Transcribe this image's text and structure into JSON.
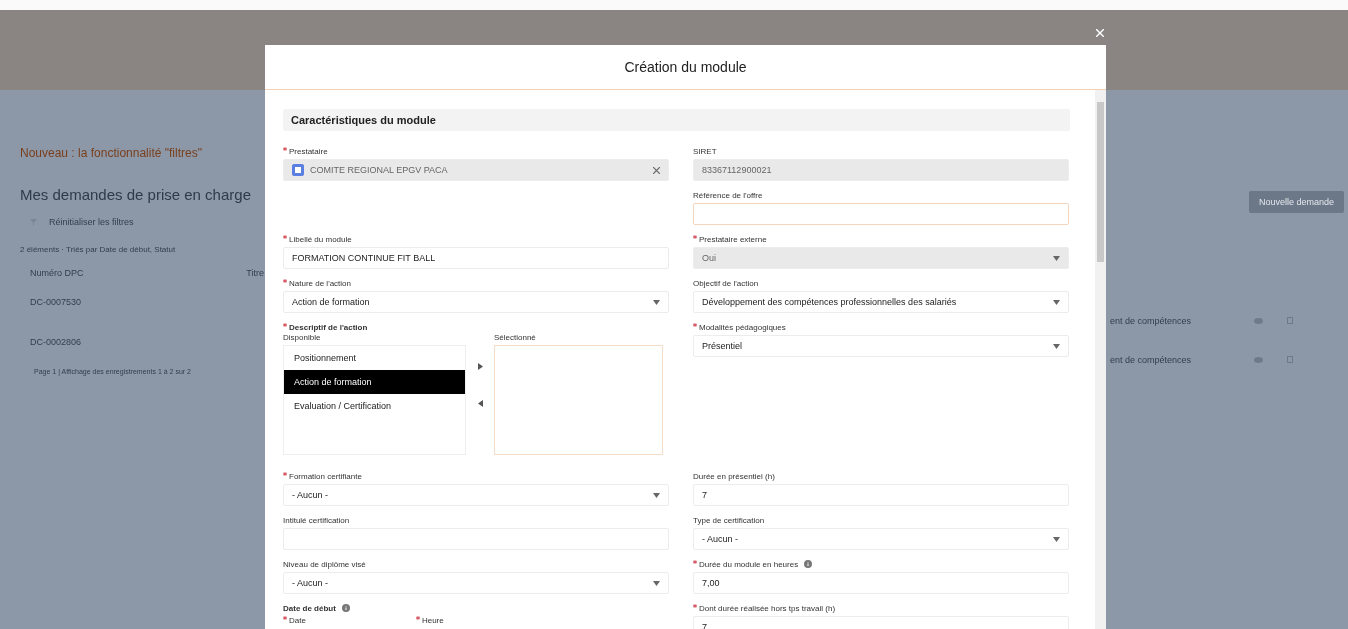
{
  "background": {
    "notice": "Nouveau : la fonctionnalité \"filtres\"",
    "title": "Mes demandes de prise en charge",
    "reset_filters": "Réinitialiser les filtres",
    "summary": "2 éléments · Triés par Date de début, Statut",
    "table": {
      "columns": [
        "Numéro DPC",
        "Titre"
      ],
      "rows": [
        {
          "number": "DC-0007530",
          "objective": "ent de compétences"
        },
        {
          "number": "DC-0002806",
          "objective": "ent de compétences"
        }
      ]
    },
    "pagination": "Page 1 | Affichage des enregistrements 1 à 2 sur 2",
    "new_request_button": "Nouvelle demande"
  },
  "modal": {
    "title": "Création du module",
    "section": "Caractéristiques du module",
    "left": [
      {
        "kind": "lookup",
        "label": "Prestataire",
        "required": true,
        "value": "COMITE REGIONAL EPGV PACA"
      },
      {
        "kind": "text",
        "label": "Libellé du module",
        "required": true,
        "value": "FORMATION CONTINUE FIT BALL"
      },
      {
        "kind": "select",
        "label": "Nature de l'action",
        "required": true,
        "value": "Action de formation"
      },
      {
        "kind": "dual_list",
        "label": "Descriptif de l'action",
        "required": true,
        "available_label": "Disponible",
        "selected_label": "Sélectionné",
        "available": [
          {
            "label": "Positionnement",
            "selected": false
          },
          {
            "label": "Action de formation",
            "selected": true
          },
          {
            "label": "Evaluation / Certification",
            "selected": false
          }
        ]
      },
      {
        "kind": "select",
        "label": "Formation certifiante",
        "required": true,
        "value": "- Aucun -"
      },
      {
        "kind": "text",
        "label": "Intitulé certification",
        "required": false
      },
      {
        "kind": "select",
        "label": "Niveau de diplôme visé",
        "required": false,
        "value": "- Aucun -"
      },
      {
        "kind": "date_group",
        "label": "Date de début",
        "info": true,
        "parts": [
          {
            "label": "Date",
            "required": true
          },
          {
            "label": "Heure",
            "required": true
          }
        ]
      }
    ],
    "right": [
      {
        "kind": "text",
        "label": "SIRET",
        "required": false,
        "disabled": true,
        "value": "83367112900021"
      },
      {
        "kind": "text",
        "label": "Référence de l'offre",
        "required": false,
        "highlight": true
      },
      {
        "kind": "select",
        "label": "Prestataire externe",
        "required": true,
        "disabled": true,
        "value": "Oui"
      },
      {
        "kind": "select",
        "label": "Objectif de l'action",
        "required": false,
        "value": "Développement des compétences professionnelles des salariés"
      },
      {
        "kind": "select",
        "label": "Modalités pédagogiques",
        "required": true,
        "value": "Présentiel"
      },
      {
        "kind": "text",
        "label": "Durée en présentiel (h)",
        "required": false,
        "value": "7"
      },
      {
        "kind": "select",
        "label": "Type de certification",
        "required": false,
        "value": "- Aucun -"
      },
      {
        "kind": "text",
        "label": "Durée du module en heures",
        "required": true,
        "info": true,
        "value": "7,00"
      },
      {
        "kind": "text",
        "label": "Dont durée réalisée hors tps travail (h)",
        "required": true,
        "value": "7"
      }
    ]
  }
}
